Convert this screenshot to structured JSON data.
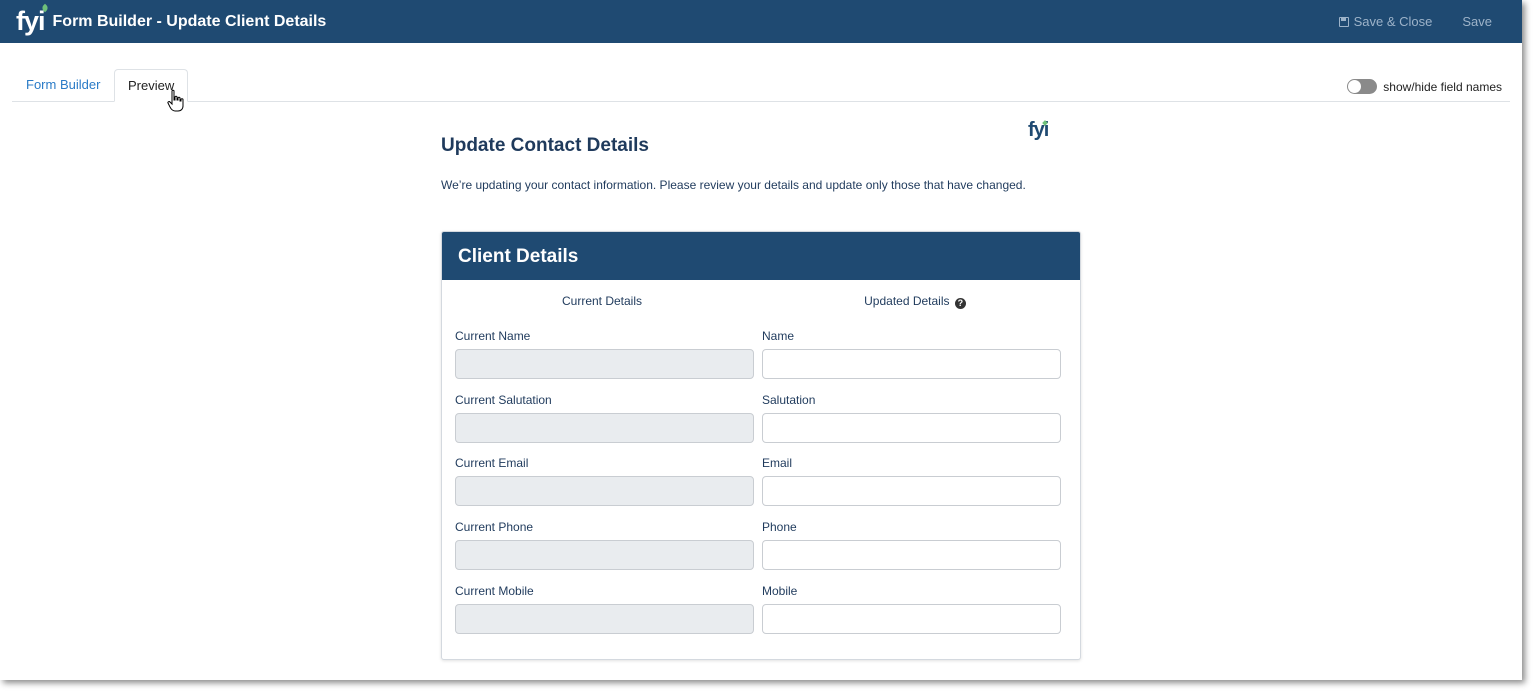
{
  "header": {
    "logo": "fyi",
    "title": "Form Builder - Update Client Details",
    "save_close_label": "Save & Close",
    "save_label": "Save"
  },
  "tabs": [
    {
      "label": "Form Builder",
      "active": false
    },
    {
      "label": "Preview",
      "active": true
    }
  ],
  "toggle": {
    "label": "show/hide field names",
    "on": false
  },
  "form": {
    "logo": "fyi",
    "title": "Update Contact Details",
    "intro": "We’re updating your contact information. Please review your details and update only those that have changed.",
    "section_title": "Client Details",
    "current_heading": "Current Details",
    "updated_heading": "Updated Details",
    "rows": [
      {
        "current_label": "Current Name",
        "current_value": "",
        "updated_label": "Name",
        "updated_value": ""
      },
      {
        "current_label": "Current Salutation",
        "current_value": "",
        "updated_label": "Salutation",
        "updated_value": ""
      },
      {
        "current_label": "Current Email",
        "current_value": "",
        "updated_label": "Email",
        "updated_value": ""
      },
      {
        "current_label": "Current Phone",
        "current_value": "",
        "updated_label": "Phone",
        "updated_value": ""
      },
      {
        "current_label": "Current Mobile",
        "current_value": "",
        "updated_label": "Mobile",
        "updated_value": ""
      }
    ]
  },
  "colors": {
    "header_bg": "#1f4a72",
    "link": "#2a7bc7",
    "accent_leaf": "#6ec07a",
    "readonly_bg": "#e9ecef"
  }
}
